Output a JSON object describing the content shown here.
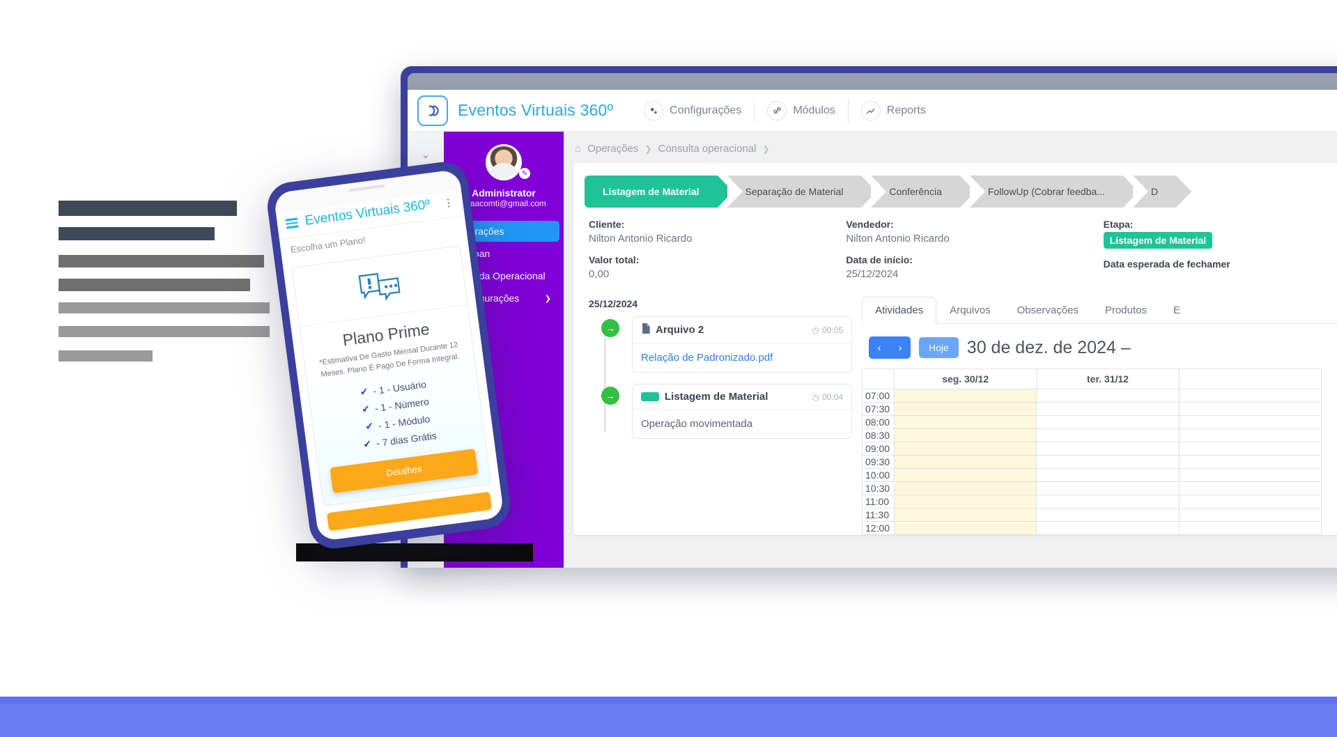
{
  "desktop": {
    "brand": {
      "title": "Eventos Virtuais 360º",
      "logo_icon": "link-chain-logo-icon"
    },
    "topnav": [
      {
        "label": "Configurações",
        "icon": "gears-icon"
      },
      {
        "label": "Módulos",
        "icon": "link-icon"
      },
      {
        "label": "Reports",
        "icon": "chart-icon"
      }
    ],
    "rail": [
      {
        "icon": "chevron-down-icon"
      },
      {
        "icon": "target-icon"
      },
      {
        "icon": "user-circle-icon"
      }
    ],
    "sidebar": {
      "user_name": "Administrator",
      "user_email": "uzaacomti@gmail.com",
      "avatar_icon": "user-avatar",
      "items": [
        {
          "label": "Operações",
          "active": true,
          "chevron": ""
        },
        {
          "label": "Kanban",
          "active": false,
          "chevron": ""
        },
        {
          "label": "Agenda Operacional",
          "active": false,
          "chevron": ""
        },
        {
          "label": "Configurações",
          "active": false,
          "chevron": "❯"
        }
      ],
      "bg_color": "#8000d7",
      "active_color": "#2196f3"
    },
    "breadcrumb": {
      "home_icon": "home-icon",
      "items": [
        "Operações",
        "Consulta operacional",
        ""
      ],
      "separator": "❯"
    },
    "stepper": [
      {
        "label": "Listagem de Material",
        "state": "done"
      },
      {
        "label": "Separação de Material",
        "state": "pending"
      },
      {
        "label": "Conferência",
        "state": "pending"
      },
      {
        "label": "FollowUp (Cobrar feedba...",
        "state": "pending"
      },
      {
        "label": "D",
        "state": "pending"
      }
    ],
    "fields": [
      {
        "label": "Cliente:",
        "value": "Nilton Antonio Ricardo"
      },
      {
        "label": "Vendedor:",
        "value": "Nilton Antonio Ricardo"
      },
      {
        "label": "Etapa:",
        "value": "Listagem de Material",
        "badge": true
      },
      {
        "label": "Valor total:",
        "value": "0,00"
      },
      {
        "label": "Data de início:",
        "value": "25/12/2024"
      },
      {
        "label": "Data esperada de fechamer",
        "value": ""
      }
    ],
    "timeline": {
      "date": "25/12/2024",
      "entries": [
        {
          "icon": "arrow-right-circle-icon",
          "title": "Arquivo 2",
          "title_icon": "file-icon",
          "time": "00:05",
          "time_icon": "clock-icon",
          "body": "Relação de Padronizado.pdf",
          "body_is_link": true
        },
        {
          "icon": "arrow-right-circle-icon",
          "title": "Listagem de Material",
          "title_icon": "green-chip-icon",
          "time": "00:04",
          "time_icon": "clock-icon",
          "body": "Operação movimentada",
          "body_is_link": false
        }
      ]
    },
    "right_panel": {
      "tabs": [
        {
          "label": "Atividades",
          "active": true
        },
        {
          "label": "Arquivos",
          "active": false
        },
        {
          "label": "Observações",
          "active": false
        },
        {
          "label": "Produtos",
          "active": false
        },
        {
          "label": "E",
          "active": false
        }
      ],
      "calendar": {
        "prev_icon": "chevron-left-icon",
        "next_icon": "chevron-right-icon",
        "today_label": "Hoje",
        "title": "30 de dez. de 2024 –",
        "time_column_header": "",
        "day_headers": [
          "seg. 30/12",
          "ter. 31/12",
          ""
        ],
        "time_slots": [
          "07:00",
          "07:30",
          "08:00",
          "08:30",
          "09:00",
          "09:30",
          "10:00",
          "10:30",
          "11:00",
          "11:30",
          "12:00"
        ],
        "highlight_column": 0,
        "highlight_color": "#fdf8dd"
      }
    }
  },
  "phone": {
    "brand": "Eventos Virtuais 360º",
    "menu_icon": "hamburger-icon",
    "kebab_icon": "more-vertical-icon",
    "subtitle": "Escolha um Plano!",
    "plan": {
      "icon": "chat-alert-icon",
      "name": "Plano Prime",
      "description": "*Estimativa De Gasto Mensal Durante 12 Meses. Plano É Pago De Forma Integral.",
      "features": [
        "- 1 - Usuário",
        "- 1 - Número",
        "- 1 - Módulo",
        "- 7 dias Grátis"
      ],
      "check_icon": "check-circle-icon",
      "button_label": "Detalhes",
      "button_color": "#fba919"
    }
  },
  "decor": {
    "band_color": "#6b7df0",
    "skeleton_label": "placeholder-text-blocks"
  }
}
